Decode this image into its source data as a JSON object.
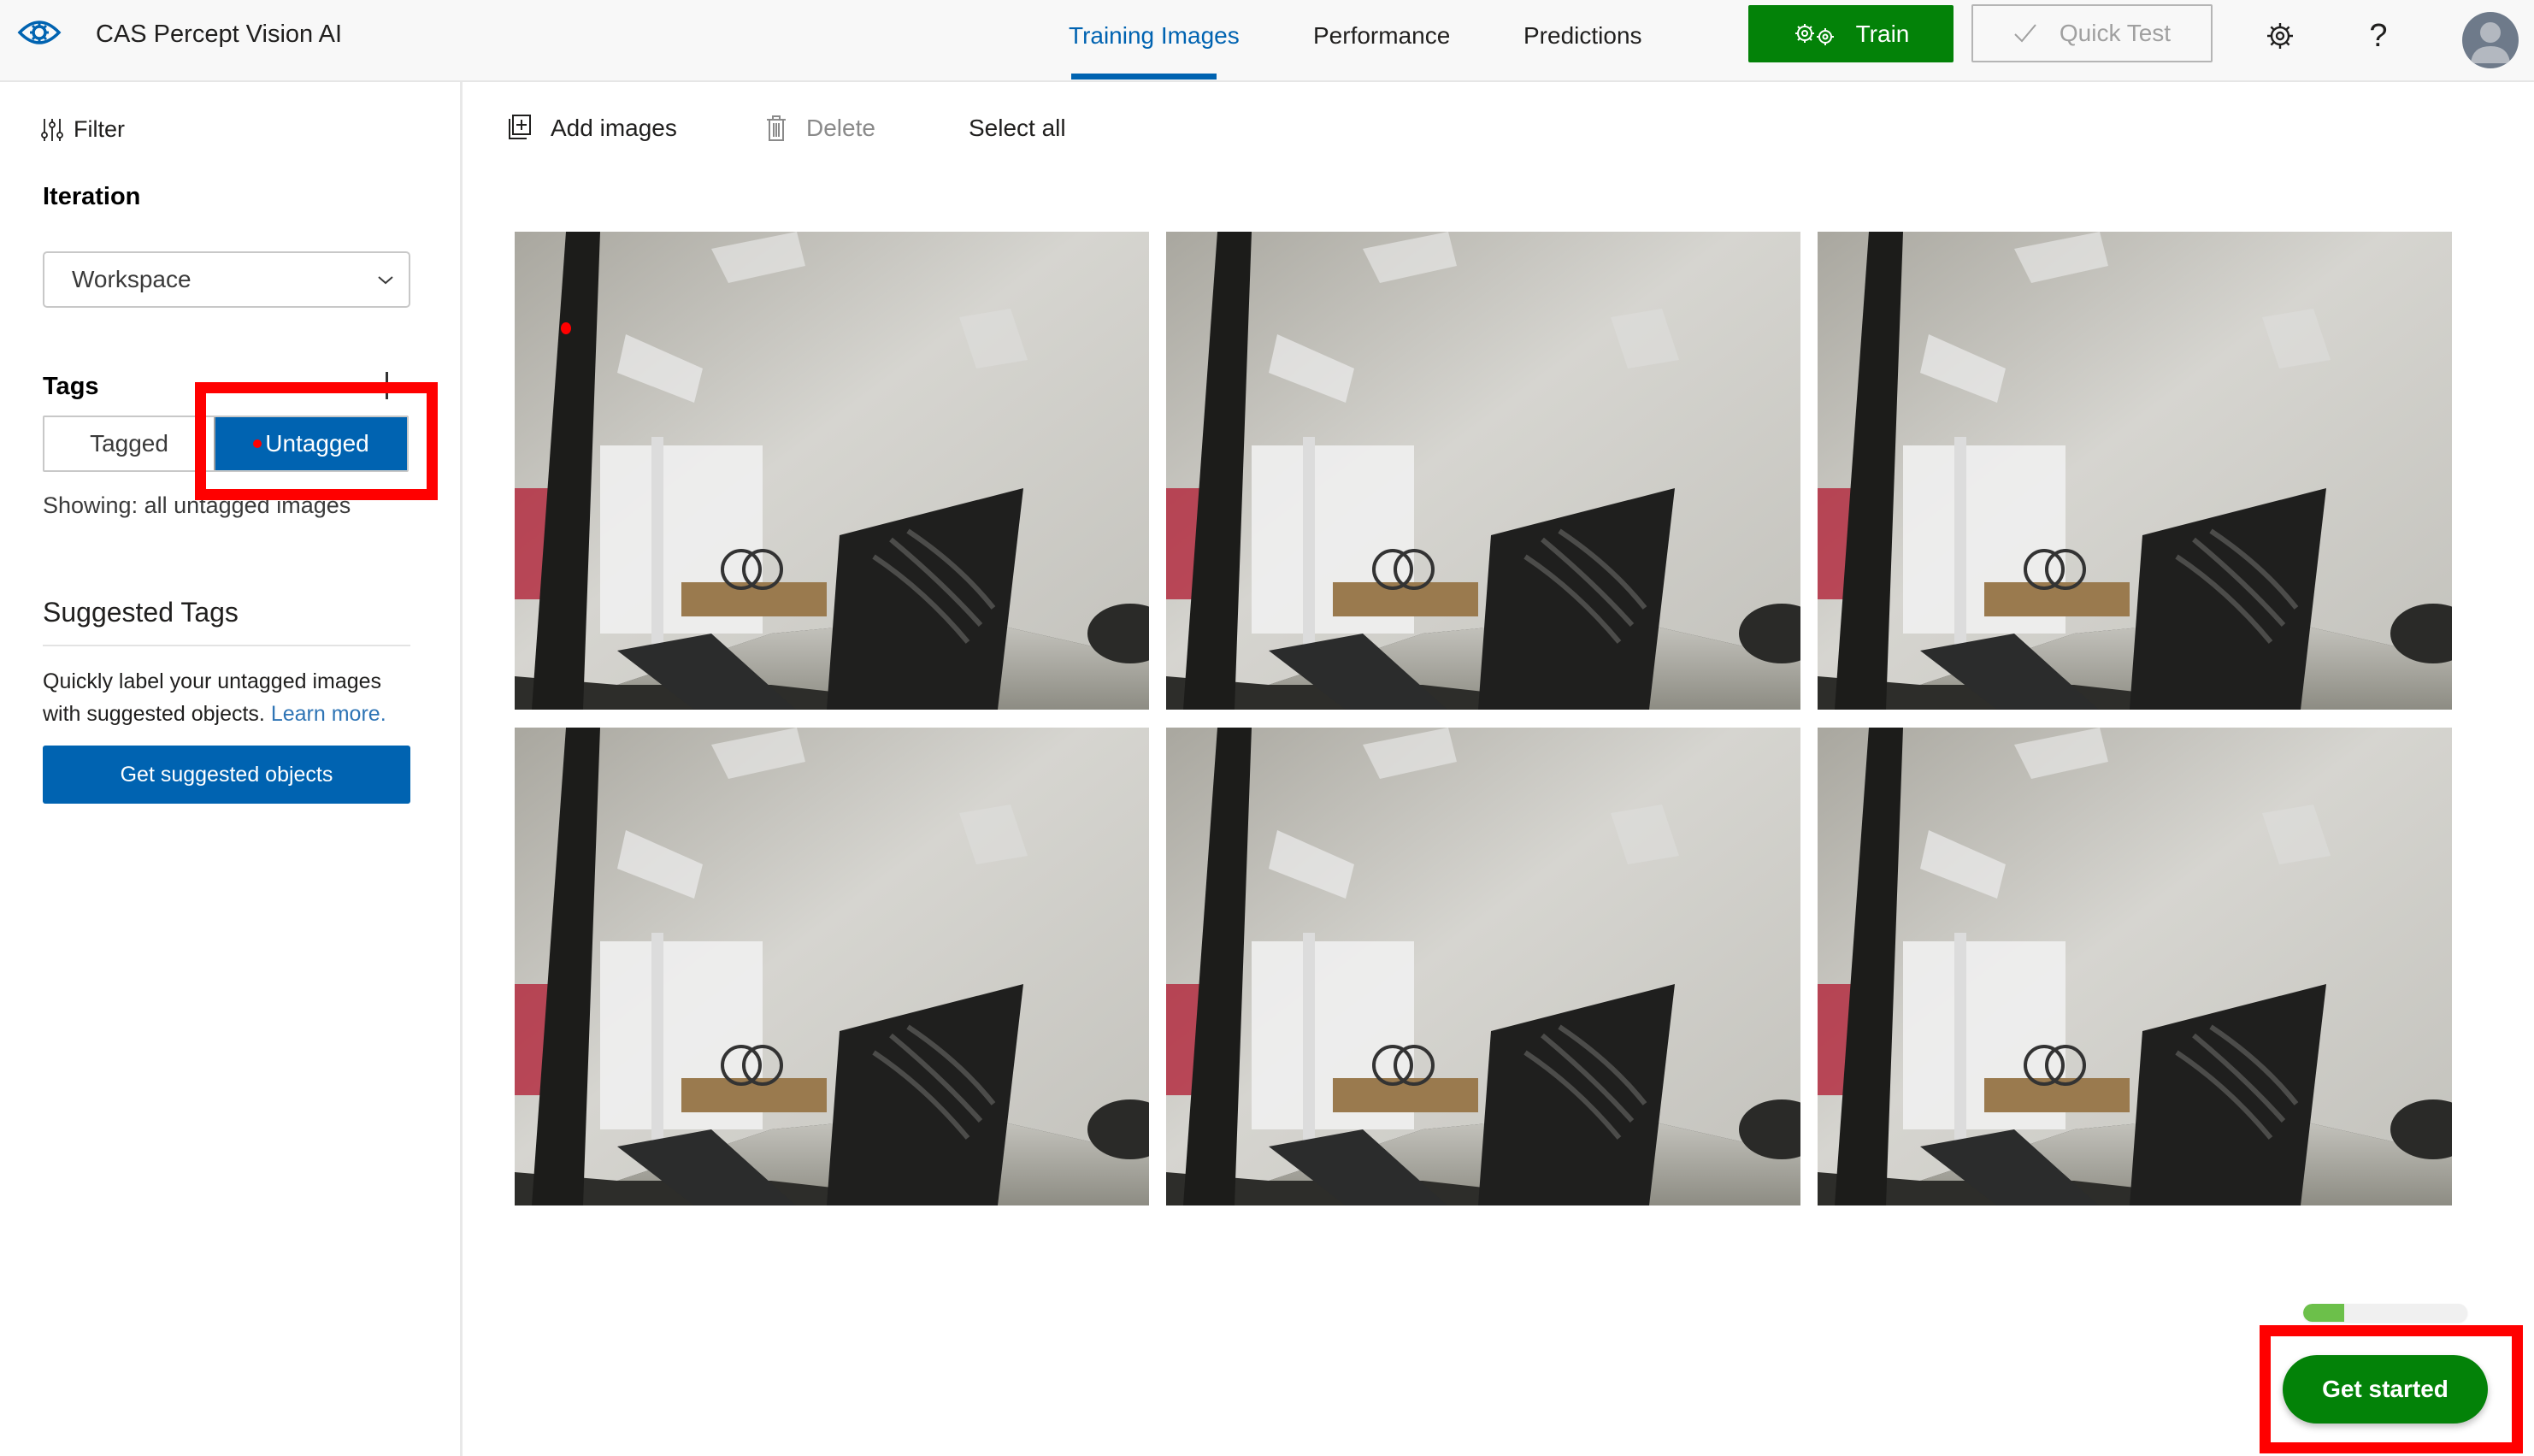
{
  "header": {
    "app_title": "CAS Percept Vision AI",
    "logo_icon": "eye-gear-icon",
    "tabs": [
      {
        "label": "Training Images",
        "active": true
      },
      {
        "label": "Performance",
        "active": false
      },
      {
        "label": "Predictions",
        "active": false
      }
    ],
    "train_label": "Train",
    "quick_test_label": "Quick Test",
    "settings_icon": "gear-icon",
    "help_icon": "question-icon",
    "avatar_icon": "user-avatar-icon"
  },
  "sidebar": {
    "filter_label": "Filter",
    "iteration_title": "Iteration",
    "iteration_selected": "Workspace",
    "tags_title": "Tags",
    "tag_toggle": [
      {
        "label": "Tagged",
        "selected": false
      },
      {
        "label": "Untagged",
        "selected": true
      }
    ],
    "showing_text": "Showing: all untagged images",
    "suggested_title": "Suggested Tags",
    "suggested_desc": "Quickly label your untagged images with suggested objects.",
    "learn_more": "Learn more.",
    "suggested_button": "Get suggested objects"
  },
  "toolbar": {
    "add_images": "Add images",
    "delete": "Delete",
    "select_all": "Select all"
  },
  "images": [
    {
      "alt": "Office scene with keyboard and mesh chair"
    },
    {
      "alt": "Office scene with keyboard and mesh chair"
    },
    {
      "alt": "Office scene with keyboard and mesh chair"
    },
    {
      "alt": "Office scene with keyboard and mesh chair"
    },
    {
      "alt": "Office scene with keyboard and mesh chair"
    },
    {
      "alt": "Office scene with keyboard and mesh chair"
    }
  ],
  "onboarding": {
    "progress_percent": 25,
    "get_started_label": "Get started"
  },
  "colors": {
    "accent_blue": "#0063b1",
    "train_green": "#038208",
    "progress_green": "#6cc04a",
    "annotation_red": "#ff0000"
  }
}
